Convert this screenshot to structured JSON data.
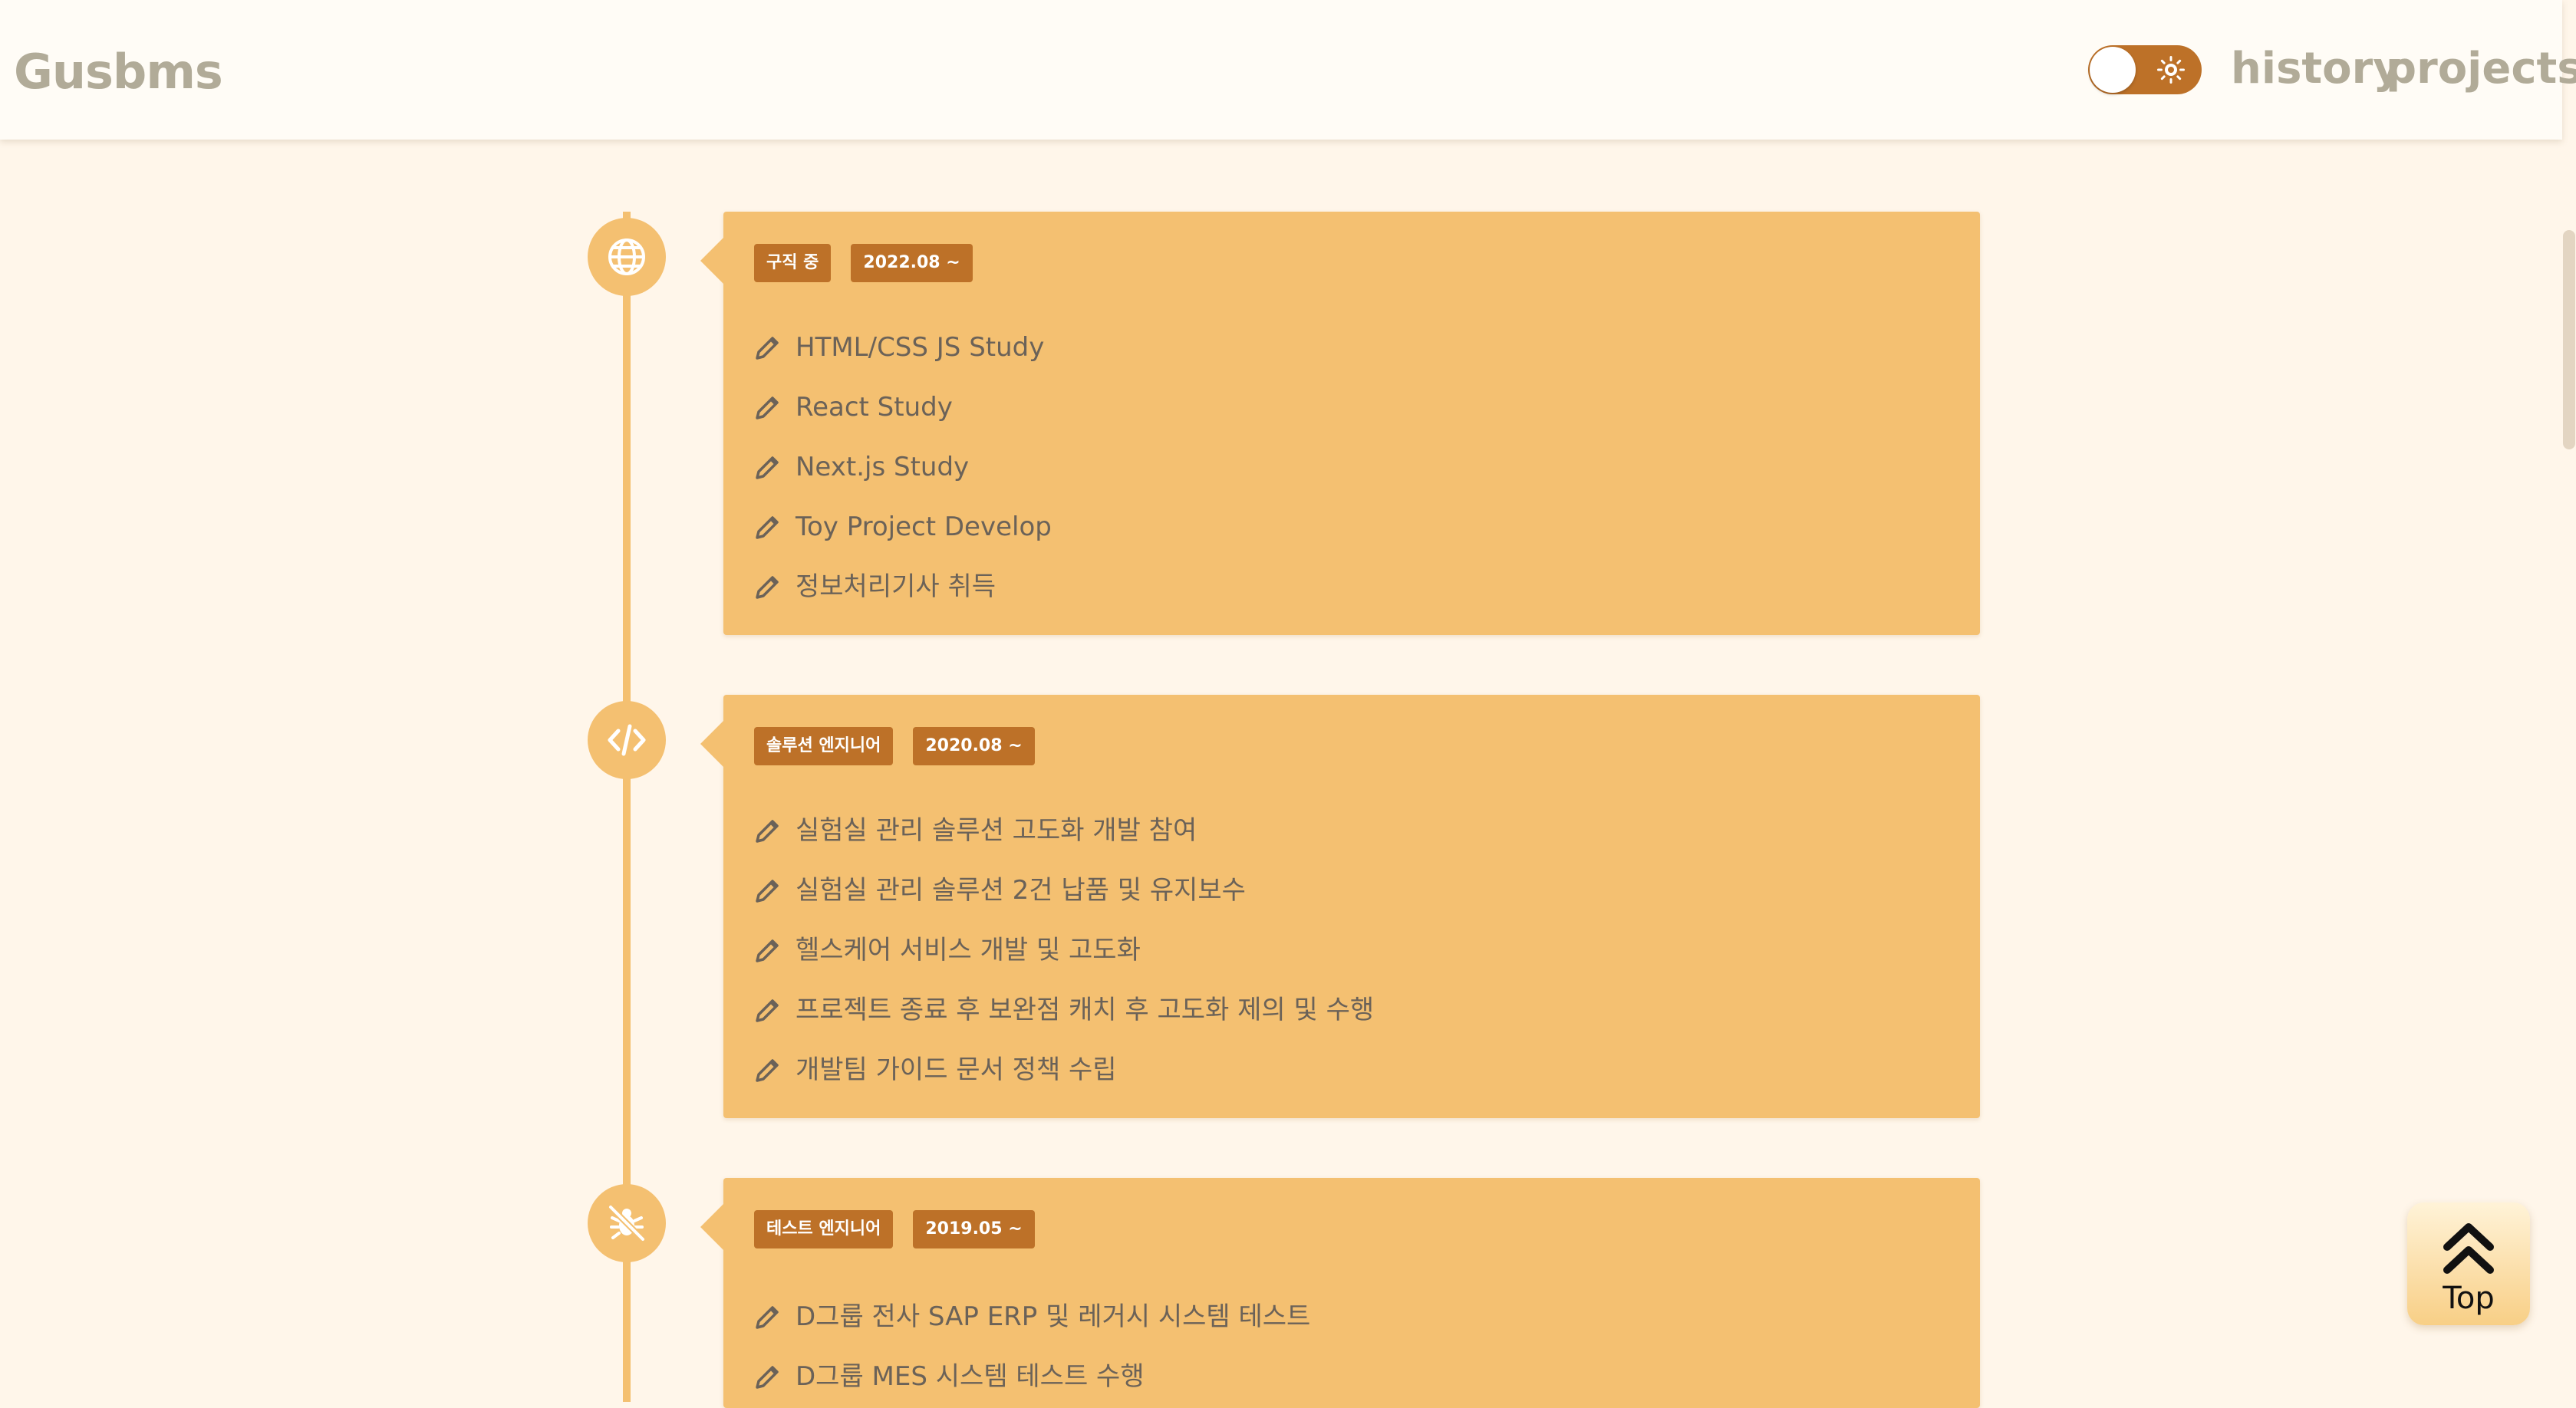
{
  "header": {
    "logo": "Gusbms",
    "nav": {
      "history": "history",
      "projects": "projects"
    }
  },
  "timeline": [
    {
      "icon": "globe-icon",
      "badges": [
        "구직 중",
        "2022.08 ~"
      ],
      "items": [
        "HTML/CSS JS Study",
        "React Study",
        "Next.js Study",
        "Toy Project Develop",
        "정보처리기사 취득"
      ]
    },
    {
      "icon": "code-icon",
      "badges": [
        "솔루션 엔지니어",
        "2020.08 ~"
      ],
      "items": [
        "실험실 관리 솔루션 고도화 개발 참여",
        "실험실 관리 솔루션 2건 납품 및 유지보수",
        "헬스케어 서비스 개발 및 고도화",
        "프로젝트 종료 후 보완점 캐치 후 고도화 제의 및 수행",
        "개발팀 가이드 문서 정책 수립"
      ]
    },
    {
      "icon": "bug-slash-icon",
      "badges": [
        "테스트 엔지니어",
        "2019.05 ~"
      ],
      "items": [
        "D그룹 전사 SAP ERP 및 레거시 시스템 테스트",
        "D그룹 MES 시스템 테스트 수행"
      ]
    }
  ],
  "top_button": {
    "label": "Top"
  },
  "colors": {
    "accent": "#f4c071",
    "badge": "#bd7128",
    "page_background": "#fff6ea",
    "header_background": "#fffcf6",
    "nav_text": "#b1ab98",
    "item_text": "#6b6258"
  }
}
